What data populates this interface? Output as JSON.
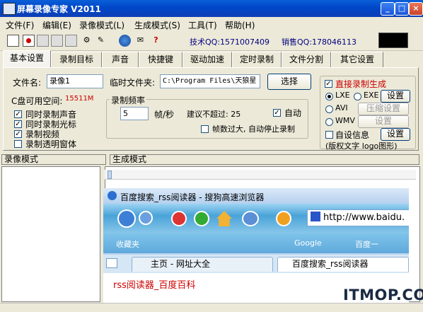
{
  "window": {
    "title": "屏幕录像专家 V2011"
  },
  "menu": [
    "文件(F)",
    "编辑(E)",
    "录像模式(L)",
    "生成模式(S)",
    "工具(T)",
    "帮助(H)"
  ],
  "toolbar": {
    "tech_qq": "技术QQ:1571007409",
    "sales_qq": "销售QQ:178046113"
  },
  "tabs": [
    "基本设置",
    "录制目标",
    "声音",
    "快捷键",
    "驱动加速",
    "定时录制",
    "文件分割",
    "其它设置"
  ],
  "basic": {
    "filename_label": "文件名:",
    "filename_value": "录像1",
    "tempdir_label": "临时文件夹:",
    "tempdir_value": "C:\\Program Files\\天狼星",
    "select_button": "选择",
    "disk_label": "C盘可用空间:",
    "disk_value": "15511M",
    "checks": [
      {
        "label": "同时录制声音",
        "checked": true
      },
      {
        "label": "同时录制光标",
        "checked": true
      },
      {
        "label": "录制视频",
        "checked": true
      },
      {
        "label": "录制透明窗体",
        "checked": false
      }
    ],
    "freq_title": "录制频率",
    "freq_value": "5",
    "freq_unit": "帧/秒",
    "suggest_label": "建议不超过: 25",
    "auto_label": "自动",
    "auto_checked": true,
    "auto_stop_label": "帧数过大, 自动停止录制"
  },
  "direct": {
    "title": "直接录制生成",
    "lxe": "LXE",
    "exe": "EXE",
    "avi": "AVI",
    "wmv": "WMV",
    "setting1": "设置",
    "compress": "压缩设置",
    "setting2": "设置",
    "custom_info": "自设信息",
    "setting3": "设置",
    "copyright": "(版权文字 logo图形)"
  },
  "sections": {
    "record_mode": "录像模式",
    "gen_mode": "生成模式"
  },
  "browser": {
    "title": "百度搜索_rss阅读器 - 搜狗高速浏览器",
    "address": "http://www.baidu.",
    "fav1": "收藏夹",
    "fav2": "Google",
    "fav3": "百度一",
    "tab1": "主页 - 网址大全",
    "tab2": "百度搜索_rss阅读器",
    "content": "rss阅读器_百度百科"
  },
  "watermark": "ITMOP.COM"
}
